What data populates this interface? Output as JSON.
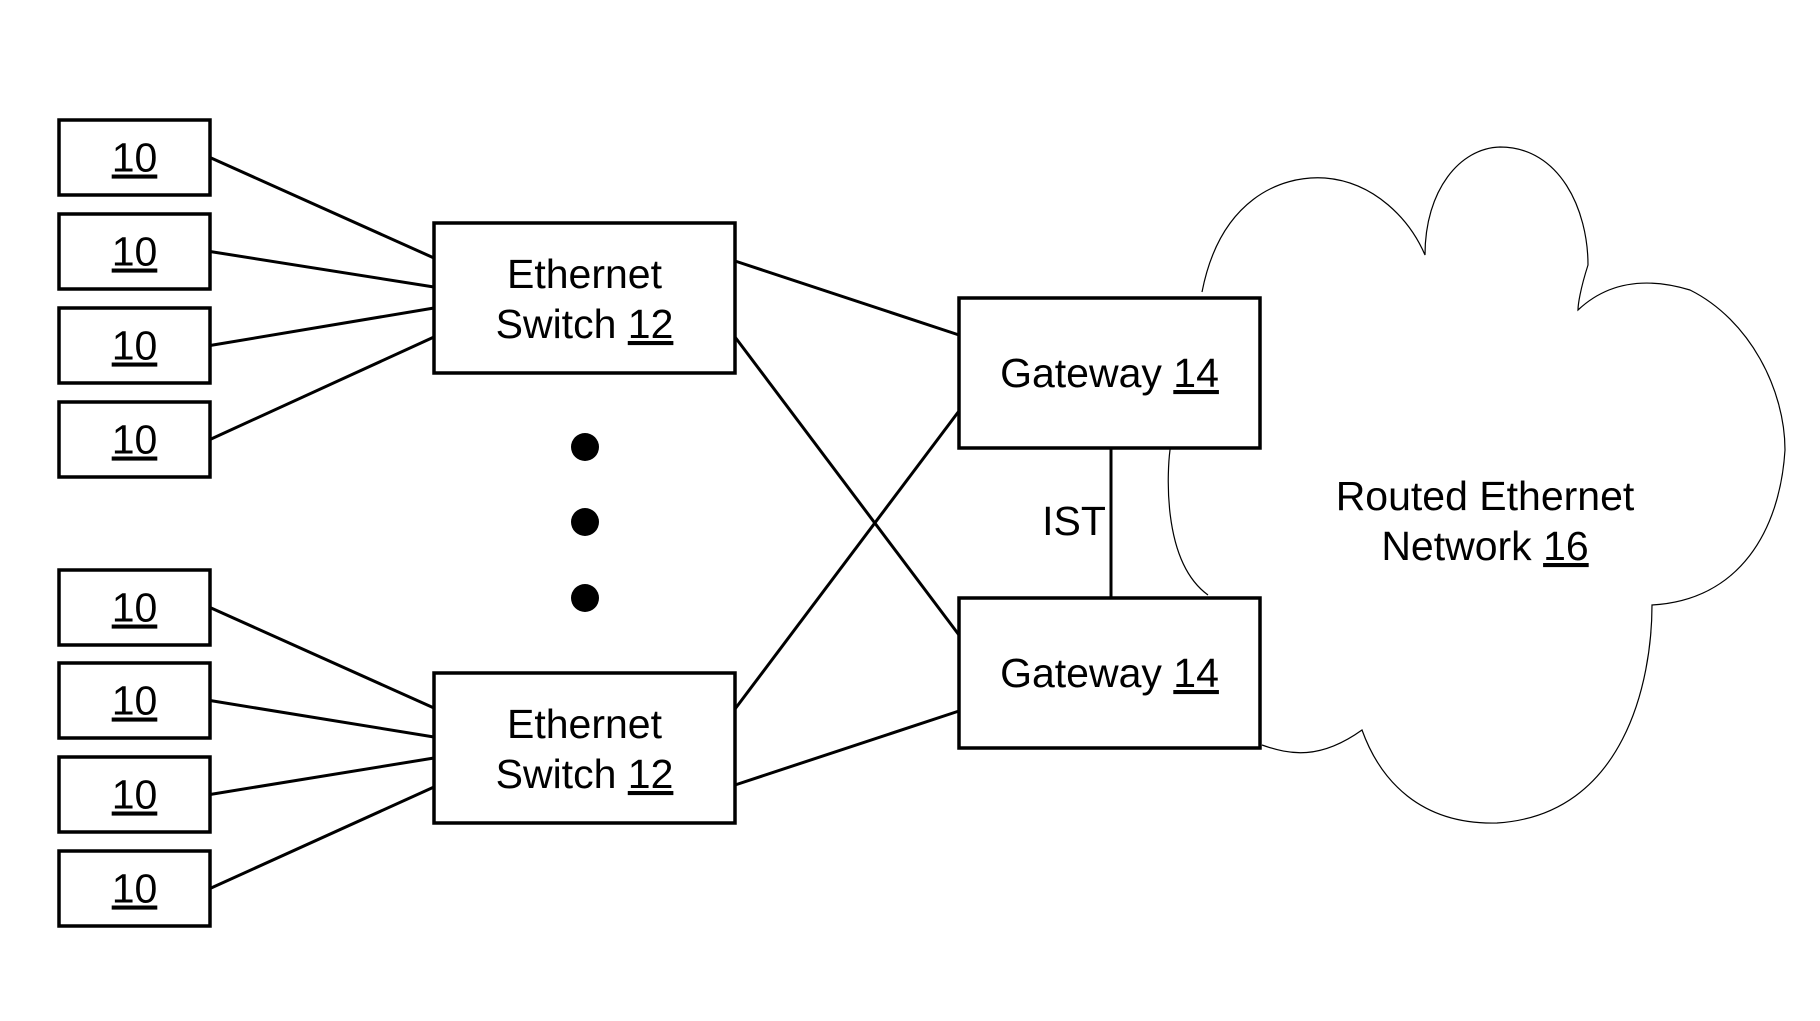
{
  "diagram": {
    "end_device_label": "10",
    "end_devices": [
      {
        "label": "10",
        "group": 0
      },
      {
        "label": "10",
        "group": 0
      },
      {
        "label": "10",
        "group": 0
      },
      {
        "label": "10",
        "group": 0
      },
      {
        "label": "10",
        "group": 1
      },
      {
        "label": "10",
        "group": 1
      },
      {
        "label": "10",
        "group": 1
      },
      {
        "label": "10",
        "group": 1
      }
    ],
    "switches": [
      {
        "line1": "Ethernet",
        "line2": "Switch ",
        "ref": "12"
      },
      {
        "line1": "Ethernet",
        "line2": "Switch ",
        "ref": "12"
      }
    ],
    "gateways": [
      {
        "text": "Gateway ",
        "ref": "14"
      },
      {
        "text": "Gateway ",
        "ref": "14"
      }
    ],
    "ist_label": "IST",
    "cloud": {
      "line1": "Routed Ethernet",
      "line2": "Network ",
      "ref": "16"
    },
    "ellipsis": "vertical-dots"
  }
}
